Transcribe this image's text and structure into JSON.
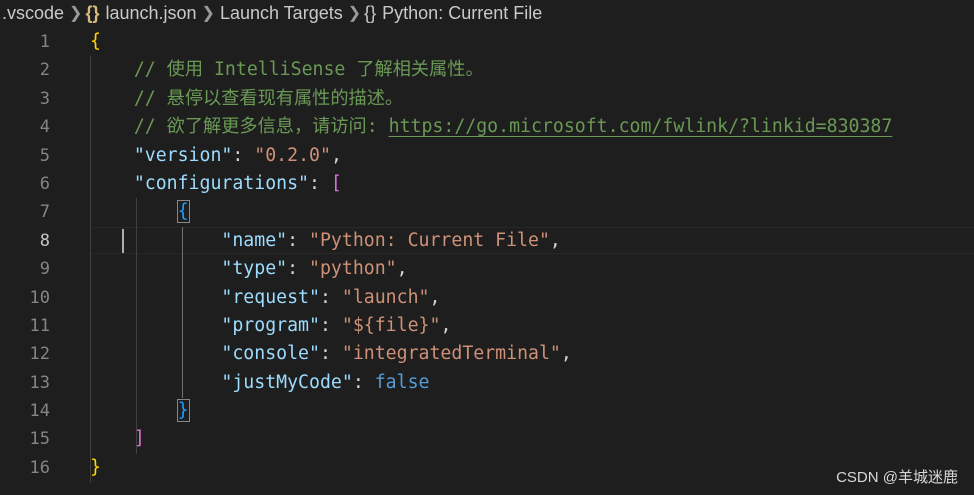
{
  "breadcrumb": {
    "folder": ".vscode",
    "file": "launch.json",
    "section": "Launch Targets",
    "item": "Python: Current File",
    "json_icon": "{}"
  },
  "editor": {
    "line_numbers": [
      "1",
      "2",
      "3",
      "4",
      "5",
      "6",
      "7",
      "8",
      "9",
      "10",
      "11",
      "12",
      "13",
      "14",
      "15",
      "16"
    ],
    "active_line": "8",
    "comments": {
      "line2": "// 使用 IntelliSense 了解相关属性。",
      "line3": "// 悬停以查看现有属性的描述。",
      "line4_prefix": "// 欲了解更多信息，请访问: ",
      "line4_link": "https://go.microsoft.com/fwlink/?linkid=830387"
    },
    "keys": {
      "version": "\"version\"",
      "configurations": "\"configurations\"",
      "name": "\"name\"",
      "type": "\"type\"",
      "request": "\"request\"",
      "program": "\"program\"",
      "console": "\"console\"",
      "justMyCode": "\"justMyCode\""
    },
    "values": {
      "version": "\"0.2.0\"",
      "name": "\"Python: Current File\"",
      "type": "\"python\"",
      "request": "\"launch\"",
      "program": "\"${file}\"",
      "console": "\"integratedTerminal\"",
      "justMyCode": "false"
    }
  },
  "watermark": "CSDN @羊城迷鹿",
  "colors": {
    "background": "#1e1e1e",
    "key": "#9cdcfe",
    "string": "#ce9178",
    "comment": "#6a9955",
    "boolean": "#569cd6",
    "bracket_level1": "#ffd700",
    "bracket_level2": "#da70d6",
    "bracket_level3": "#179fff"
  }
}
